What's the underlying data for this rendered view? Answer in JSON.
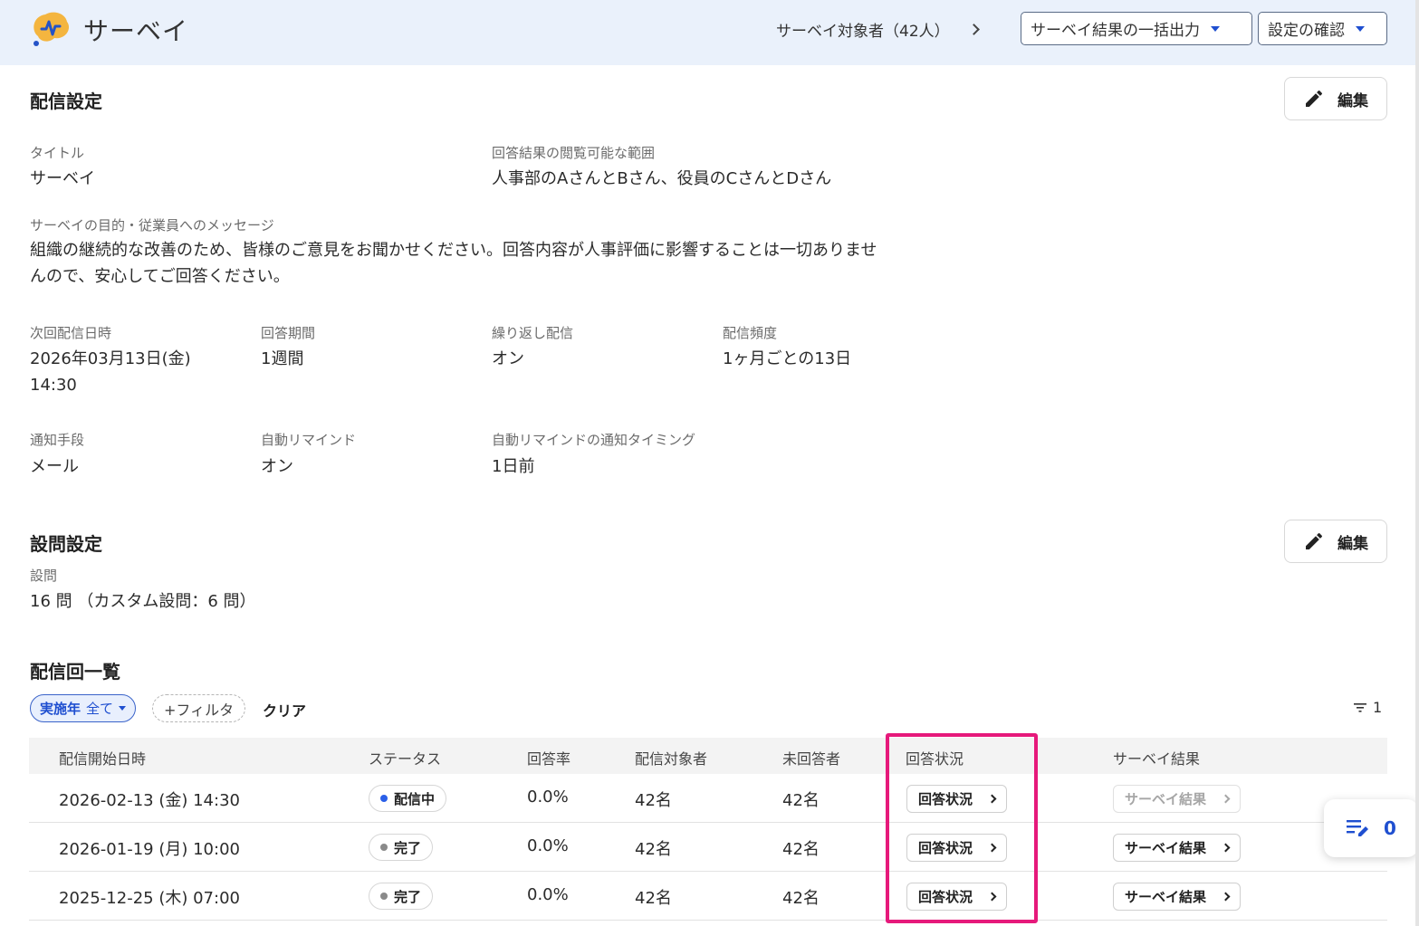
{
  "header": {
    "app_title": "サーベイ",
    "target_label": "サーベイ対象者（42人）",
    "export_label": "サーベイ結果の一括出力",
    "settings_label": "設定の確認"
  },
  "delivery": {
    "section_title": "配信設定",
    "edit_label": "編集",
    "title_label": "タイトル",
    "title_value": "サーベイ",
    "scope_label": "回答結果の閲覧可能な範囲",
    "scope_value": "人事部のAさんとBさん、役員のCさんとDさん",
    "purpose_label": "サーベイの目的・従業員へのメッセージ",
    "purpose_line1": "組織の継続的な改善のため、皆様のご意見をお聞かせください。回答内容が人事評価に影響することは一切ありませ",
    "purpose_line2": "んので、安心してご回答ください。",
    "next_label": "次回配信日時",
    "next_date": "2026年03月13日(金)",
    "next_time": "14:30",
    "period_label": "回答期間",
    "period_value": "1週間",
    "repeat_label": "繰り返し配信",
    "repeat_value": "オン",
    "freq_label": "配信頻度",
    "freq_value": "1ヶ月ごとの13日",
    "notify_label": "通知手段",
    "notify_value": "メール",
    "remind_label": "自動リマインド",
    "remind_value": "オン",
    "remind_timing_label": "自動リマインドの通知タイミング",
    "remind_timing_value": "1日前"
  },
  "questions": {
    "section_title": "設問設定",
    "edit_label": "編集",
    "label": "設問",
    "value": "16 問 （カスタム設問：6 問）"
  },
  "deliveries": {
    "section_title": "配信回一覧",
    "filter_year_label": "実施年",
    "filter_year_value": "全て",
    "add_filter_label": "+フィルタ",
    "clear_label": "クリア",
    "sort_count": "1",
    "columns": [
      "配信開始日時",
      "ステータス",
      "回答率",
      "配信対象者",
      "未回答者",
      "回答状況",
      "サーベイ結果"
    ],
    "rows": [
      {
        "date": "2026-02-13 (金) 14:30",
        "status": "配信中",
        "status_color": "#2a5fe8",
        "rate": "0.0%",
        "targets": "42名",
        "unanswered": "42名",
        "answer_btn": "回答状況",
        "result_btn": "サーベイ結果",
        "result_enabled": false
      },
      {
        "date": "2026-01-19 (月) 10:00",
        "status": "完了",
        "status_color": "#8a8a8a",
        "rate": "0.0%",
        "targets": "42名",
        "unanswered": "42名",
        "answer_btn": "回答状況",
        "result_btn": "サーベイ結果",
        "result_enabled": true
      },
      {
        "date": "2025-12-25 (木) 07:00",
        "status": "完了",
        "status_color": "#8a8a8a",
        "rate": "0.0%",
        "targets": "42名",
        "unanswered": "42名",
        "answer_btn": "回答状況",
        "result_btn": "サーベイ結果",
        "result_enabled": true
      }
    ]
  },
  "widget": {
    "count": "0"
  },
  "colors": {
    "accent": "#1f4fd0",
    "highlight": "#e6197b",
    "header_bg": "#eaf1fb"
  },
  "icons": [
    "survey-logo-icon",
    "chevron-right-icon",
    "caret-down-icon",
    "pencil-icon",
    "sort-filter-icon",
    "memo-edit-icon"
  ]
}
